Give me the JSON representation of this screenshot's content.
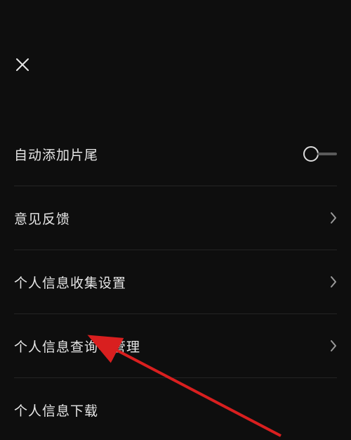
{
  "header": {
    "close_icon": "close"
  },
  "items": [
    {
      "label": "自动添加片尾",
      "type": "toggle",
      "toggled": false
    },
    {
      "label": "意见反馈",
      "type": "nav"
    },
    {
      "label": "个人信息收集设置",
      "type": "nav"
    },
    {
      "label": "个人信息查询与管理",
      "type": "nav"
    },
    {
      "label": "个人信息下载",
      "type": "nav"
    }
  ],
  "annotation": {
    "arrow_color": "#d91f1f",
    "target_item_index": 3
  }
}
